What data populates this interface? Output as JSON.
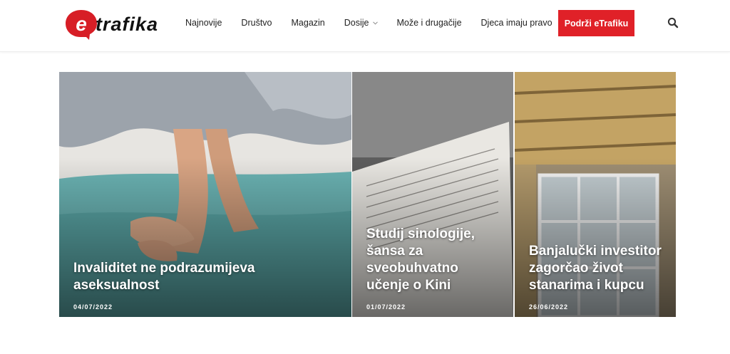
{
  "brand": {
    "name": "eTrafika",
    "accent": "#e02128"
  },
  "nav": {
    "items": [
      {
        "label": "Najnovije"
      },
      {
        "label": "Društvo"
      },
      {
        "label": "Magazin"
      },
      {
        "label": "Dosije"
      },
      {
        "label": "Može i drugačije"
      },
      {
        "label": "Djeca imaju pravo"
      }
    ],
    "cta_label": "Podrži eTrafiku",
    "search_icon": "search-icon"
  },
  "articles": [
    {
      "title": "Invaliditet ne podrazumijeva aseksualnost",
      "date": "04/07/2022"
    },
    {
      "title": "Studij sinologije, šansa za sveobuhvatno učenje o Kini",
      "date": "01/07/2022"
    },
    {
      "title": "Banjalučki investitor zagorčao život stanarima i kupcu",
      "date": "26/06/2022"
    }
  ]
}
